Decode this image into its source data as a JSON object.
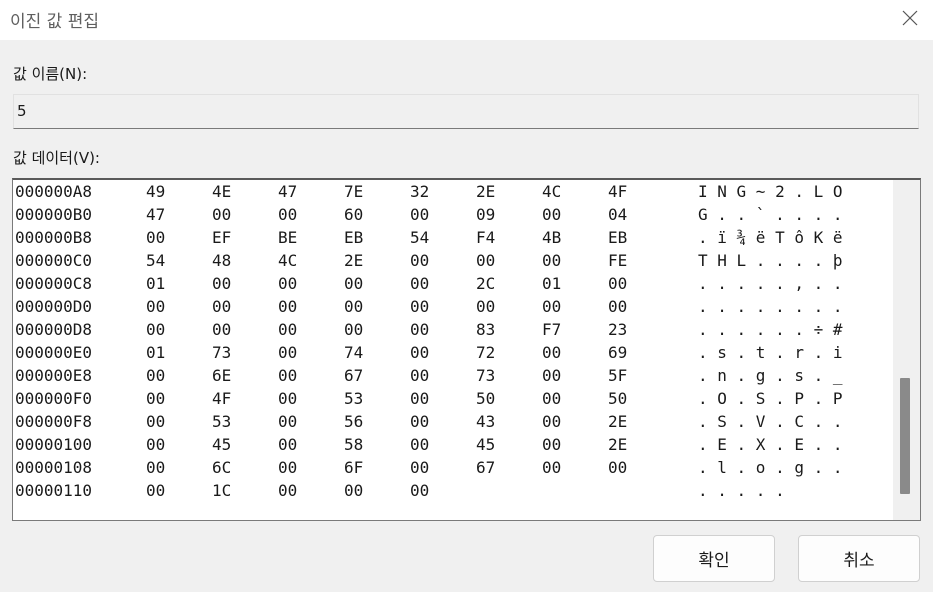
{
  "window": {
    "title": "이진 값 편집"
  },
  "value_name": {
    "label": "값 이름(N):",
    "value": "5"
  },
  "value_data": {
    "label": "값 데이터(V):",
    "rows": [
      {
        "addr": "000000A8",
        "bytes": [
          "49",
          "4E",
          "47",
          "7E",
          "32",
          "2E",
          "4C",
          "4F"
        ],
        "ascii": "I N G ~ 2 . L O"
      },
      {
        "addr": "000000B0",
        "bytes": [
          "47",
          "00",
          "00",
          "60",
          "00",
          "09",
          "00",
          "04"
        ],
        "ascii": "G . . ` . . . ."
      },
      {
        "addr": "000000B8",
        "bytes": [
          "00",
          "EF",
          "BE",
          "EB",
          "54",
          "F4",
          "4B",
          "EB"
        ],
        "ascii": ". ï ¾ ë T ô K ë"
      },
      {
        "addr": "000000C0",
        "bytes": [
          "54",
          "48",
          "4C",
          "2E",
          "00",
          "00",
          "00",
          "FE"
        ],
        "ascii": "T H L . . . . þ"
      },
      {
        "addr": "000000C8",
        "bytes": [
          "01",
          "00",
          "00",
          "00",
          "00",
          "2C",
          "01",
          "00"
        ],
        "ascii": ". . . . . , . ."
      },
      {
        "addr": "000000D0",
        "bytes": [
          "00",
          "00",
          "00",
          "00",
          "00",
          "00",
          "00",
          "00"
        ],
        "ascii": ". . . . . . . ."
      },
      {
        "addr": "000000D8",
        "bytes": [
          "00",
          "00",
          "00",
          "00",
          "00",
          "83",
          "F7",
          "23"
        ],
        "ascii": ". . . . . . ÷ #"
      },
      {
        "addr": "000000E0",
        "bytes": [
          "01",
          "73",
          "00",
          "74",
          "00",
          "72",
          "00",
          "69"
        ],
        "ascii": ". s . t . r . i"
      },
      {
        "addr": "000000E8",
        "bytes": [
          "00",
          "6E",
          "00",
          "67",
          "00",
          "73",
          "00",
          "5F"
        ],
        "ascii": ". n . g . s . _"
      },
      {
        "addr": "000000F0",
        "bytes": [
          "00",
          "4F",
          "00",
          "53",
          "00",
          "50",
          "00",
          "50"
        ],
        "ascii": ". O . S . P . P"
      },
      {
        "addr": "000000F8",
        "bytes": [
          "00",
          "53",
          "00",
          "56",
          "00",
          "43",
          "00",
          "2E"
        ],
        "ascii": ". S . V . C . ."
      },
      {
        "addr": "00000100",
        "bytes": [
          "00",
          "45",
          "00",
          "58",
          "00",
          "45",
          "00",
          "2E"
        ],
        "ascii": ". E . X . E . ."
      },
      {
        "addr": "00000108",
        "bytes": [
          "00",
          "6C",
          "00",
          "6F",
          "00",
          "67",
          "00",
          "00"
        ],
        "ascii": ". l . o . g . ."
      },
      {
        "addr": "00000110",
        "bytes": [
          "00",
          "1C",
          "00",
          "00",
          "00",
          "",
          "",
          ""
        ],
        "ascii": ". . . . ."
      }
    ]
  },
  "buttons": {
    "ok": "확인",
    "cancel": "취소"
  },
  "icons": {
    "close": "close-icon"
  },
  "colors": {
    "background": "#f0f0f0",
    "scrollbar_thumb": "#8a8a8a"
  }
}
